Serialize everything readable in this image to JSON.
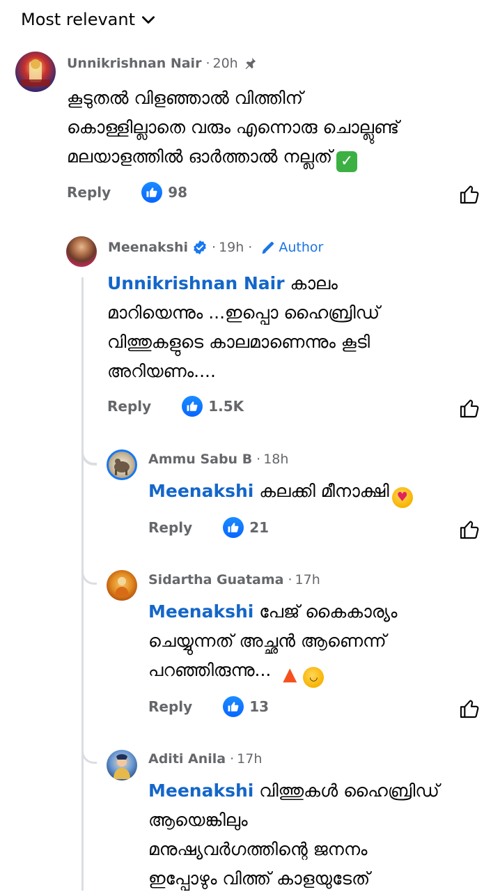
{
  "sort": {
    "label": "Most relevant"
  },
  "comments": [
    {
      "author": "Unnikrishnan Nair",
      "time": "20h",
      "mention": "",
      "lines": [
        "കൂടുതൽ വിളഞ്ഞാൽ വിത്തിന്",
        "കൊള്ളില്ലാതെ വരും എന്നൊരു ചൊല്ലുണ്ട്",
        "മലയാളത്തിൽ ഓർത്താൽ നല്ലത്"
      ],
      "reply": "Reply",
      "reactions": "98"
    },
    {
      "author": "Meenakshi",
      "time": "19h",
      "badge": "Author",
      "mention": "Unnikrishnan Nair",
      "lines": [
        "കാലം",
        "മാറിയെന്നും ...ഇപ്പൊ  ഹൈബ്രിഡ്",
        "വിത്തുകളുടെ കാലമാണെന്നും  കൂടി",
        "അറിയണം...."
      ],
      "reply": "Reply",
      "reactions": "1.5K"
    },
    {
      "author": "Ammu Sabu B",
      "time": "18h",
      "mention": "Meenakshi",
      "lines": [
        "കലക്കി മീനാക്ഷി"
      ],
      "reply": "Reply",
      "reactions": "21"
    },
    {
      "author": "Sidartha Guatama",
      "time": "17h",
      "mention": "Meenakshi",
      "lines": [
        "പേജ് കൈകാര്യം",
        "ചെയ്യുന്നത് അച്ഛൻ ആണെന്ന്",
        "പറഞ്ഞിരുന്നു..."
      ],
      "reply": "Reply",
      "reactions": "13"
    },
    {
      "author": "Aditi Anila",
      "time": "17h",
      "mention": "Meenakshi",
      "lines": [
        "വിത്തുകൾ ഹൈബ്രിഡ്",
        "ആയെങ്കിലും",
        "മനുഷ്യവർഗത്തിന്റെ ജനനം",
        "ഇപ്പോഴും വിത്ത് കാളയുടേത്"
      ],
      "reply": "",
      "reactions": ""
    }
  ],
  "colors": {
    "link": "#1466c9",
    "meta": "#65676b",
    "like_blue": "#0866ff",
    "thread_line": "#dadde1"
  }
}
